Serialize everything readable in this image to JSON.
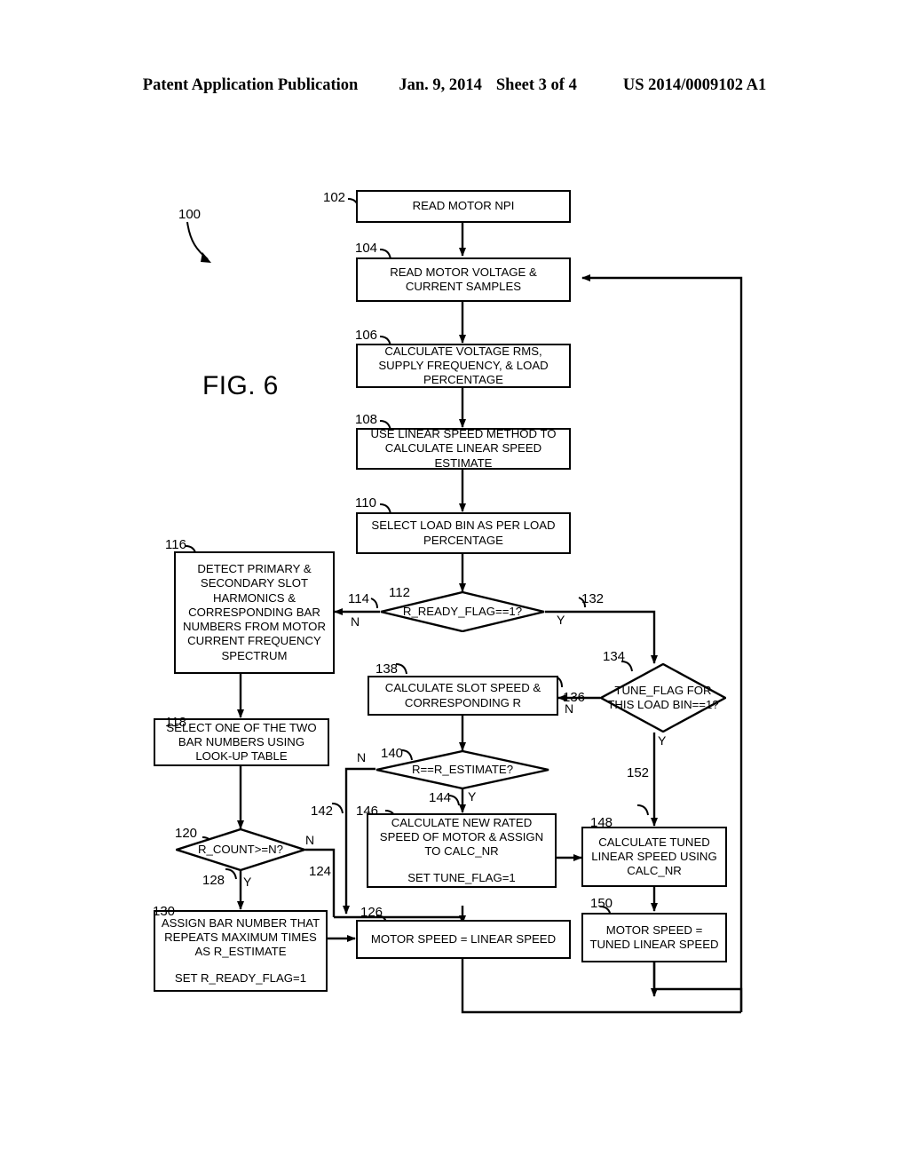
{
  "header": {
    "publication": "Patent Application Publication",
    "date": "Jan. 9, 2014",
    "sheet": "Sheet 3 of 4",
    "number": "US 2014/0009102 A1"
  },
  "figure": {
    "label": "FIG. 6",
    "diagram_ref": "100"
  },
  "nodes": {
    "n102": {
      "ref": "102",
      "text": "READ MOTOR NPI"
    },
    "n104": {
      "ref": "104",
      "text": "READ MOTOR VOLTAGE & CURRENT SAMPLES"
    },
    "n106": {
      "ref": "106",
      "text": "CALCULATE VOLTAGE RMS, SUPPLY FREQUENCY, & LOAD PERCENTAGE"
    },
    "n108": {
      "ref": "108",
      "text": "USE LINEAR SPEED METHOD TO CALCULATE LINEAR SPEED ESTIMATE"
    },
    "n110": {
      "ref": "110",
      "text": "SELECT LOAD BIN AS PER LOAD PERCENTAGE"
    },
    "n112": {
      "ref": "112",
      "text": "R_READY_FLAG==1?"
    },
    "n116": {
      "ref": "116",
      "text": "DETECT PRIMARY & SECONDARY SLOT HARMONICS & CORRESPONDING BAR NUMBERS FROM MOTOR CURRENT FREQUENCY SPECTRUM"
    },
    "n118": {
      "ref": "118",
      "text": "SELECT ONE OF THE TWO BAR NUMBERS USING LOOK-UP TABLE"
    },
    "n120": {
      "ref": "120",
      "text": "R_COUNT>=N?"
    },
    "n126": {
      "ref": "126",
      "text": "MOTOR SPEED = LINEAR SPEED"
    },
    "n130": {
      "ref": "130",
      "text": "ASSIGN BAR NUMBER THAT REPEATS MAXIMUM TIMES AS R_ESTIMATE",
      "text2": "SET R_READY_FLAG=1"
    },
    "n134": {
      "ref": "134",
      "text": "TUNE_FLAG FOR THIS LOAD BIN==1?"
    },
    "n138": {
      "ref": "138",
      "text": "CALCULATE SLOT SPEED & CORRESPONDING R"
    },
    "n140": {
      "ref": "140",
      "text": "R==R_ESTIMATE?"
    },
    "n146": {
      "ref": "146",
      "text": "CALCULATE NEW RATED SPEED OF MOTOR & ASSIGN TO CALC_NR",
      "text2": "SET TUNE_FLAG=1"
    },
    "n148": {
      "ref": "148",
      "text": "CALCULATE TUNED LINEAR SPEED USING CALC_NR"
    },
    "n150": {
      "ref": "150",
      "text": "MOTOR SPEED = TUNED LINEAR SPEED"
    }
  },
  "edges": {
    "e114": {
      "ref": "114",
      "label": "N"
    },
    "e132": {
      "ref": "132",
      "label": "Y"
    },
    "e136": {
      "ref": "136",
      "label": "N"
    },
    "e152": {
      "ref": "152",
      "label": "Y"
    },
    "e142": {
      "ref": "142",
      "label": "N"
    },
    "e124": {
      "ref": "124"
    },
    "e128": {
      "ref": "128",
      "label": "Y"
    },
    "e144": {
      "ref": "144",
      "label": "Y"
    },
    "y134": {
      "label": "Y"
    }
  },
  "colors": {
    "ink": "#000000",
    "paper": "#ffffff"
  }
}
